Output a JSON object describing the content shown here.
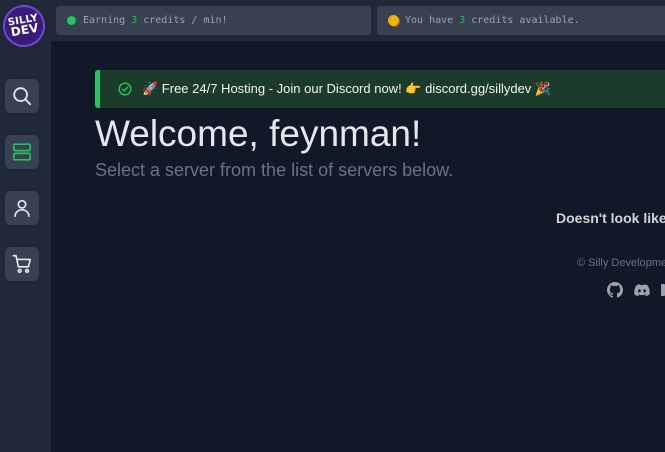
{
  "sidebar": {
    "logo": {
      "line1": "SILLY",
      "line2": "DEV"
    },
    "items": [
      {
        "icon": "search-icon",
        "active": false
      },
      {
        "icon": "server-icon",
        "active": true
      },
      {
        "icon": "user-icon",
        "active": false
      },
      {
        "icon": "cart-icon",
        "active": false
      }
    ]
  },
  "topbar": {
    "earning": {
      "prefix": "Earning ",
      "value": "3",
      "suffix": " credits / min!"
    },
    "credits": {
      "prefix": "You have ",
      "value": "3",
      "suffix": " credits available."
    }
  },
  "alert": {
    "text": "🚀 Free 24/7 Hosting - Join our Discord now! 👉 discord.gg/sillydev 🎉"
  },
  "main": {
    "welcome": "Welcome, feynman!",
    "subtitle": "Select a server from the list of servers below.",
    "note": "Doesn't look like",
    "copyright": "© Silly Developme"
  },
  "colors": {
    "background": "#111827",
    "panel": "#1f2937",
    "accent": "#22c55e"
  }
}
